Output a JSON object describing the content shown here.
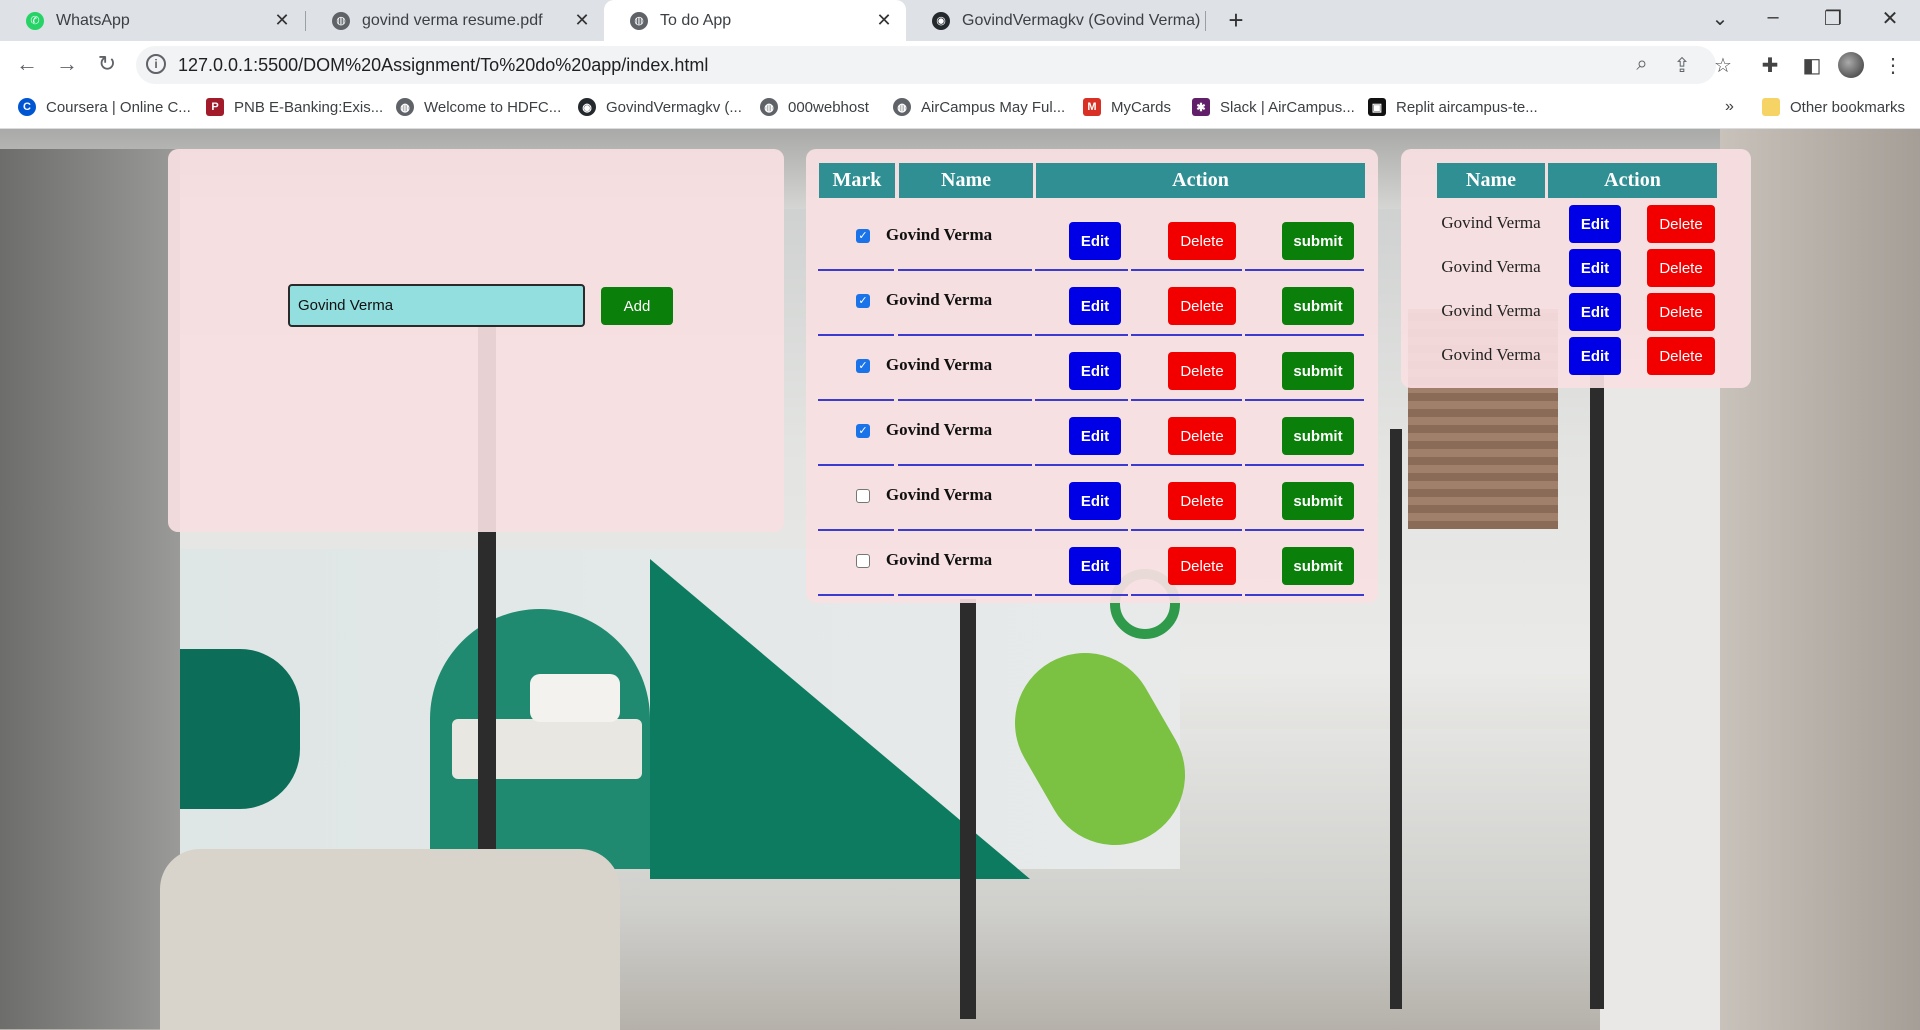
{
  "browser": {
    "tabs": [
      {
        "label": "WhatsApp",
        "icon": "whatsapp-icon",
        "color": "#25d366"
      },
      {
        "label": "govind verma resume.pdf",
        "icon": "globe-icon",
        "color": "#5f6368"
      },
      {
        "label": "To do App",
        "icon": "globe-icon",
        "color": "#5f6368"
      },
      {
        "label": "GovindVermagkv (Govind Verma)",
        "icon": "github-icon",
        "color": "#24292e"
      }
    ],
    "active_tab": 2,
    "url": "127.0.0.1:5500/DOM%20Assignment/To%20do%20app/index.html",
    "bookmarks": [
      {
        "label": "Coursera | Online C...",
        "icon": "coursera-icon",
        "color": "#0056d2",
        "glyph": "C"
      },
      {
        "label": "PNB E-Banking:Exis...",
        "icon": "pnb-icon",
        "color": "#a21b2b",
        "glyph": "P"
      },
      {
        "label": "Welcome to HDFC...",
        "icon": "globe-icon",
        "color": "#5f6368",
        "glyph": "◍"
      },
      {
        "label": "GovindVermagkv (...",
        "icon": "github-icon",
        "color": "#24292e",
        "glyph": "◉"
      },
      {
        "label": "000webhost",
        "icon": "globe-icon",
        "color": "#5f6368",
        "glyph": "◍"
      },
      {
        "label": "AirCampus May Ful...",
        "icon": "globe-icon",
        "color": "#5f6368",
        "glyph": "◍"
      },
      {
        "label": "MyCards",
        "icon": "mycards-icon",
        "color": "#d93025",
        "glyph": "M"
      },
      {
        "label": "Slack | AirCampus...",
        "icon": "slack-icon",
        "color": "#611f69",
        "glyph": "✱"
      },
      {
        "label": "Replit aircampus-te...",
        "icon": "replit-icon",
        "color": "#111111",
        "glyph": "▣"
      }
    ],
    "overflow_label": "»",
    "other_bookmarks": "Other bookmarks"
  },
  "app": {
    "input": {
      "value": "Govind Verma"
    },
    "add_label": "Add",
    "table": {
      "headers": {
        "mark": "Mark",
        "name": "Name",
        "action": "Action"
      },
      "rows": [
        {
          "checked": true,
          "name": "Govind Verma"
        },
        {
          "checked": true,
          "name": "Govind Verma"
        },
        {
          "checked": true,
          "name": "Govind Verma"
        },
        {
          "checked": true,
          "name": "Govind Verma"
        },
        {
          "checked": false,
          "name": "Govind Verma"
        },
        {
          "checked": false,
          "name": "Govind Verma"
        }
      ],
      "edit_label": "Edit",
      "delete_label": "Delete",
      "submit_label": "submit"
    },
    "submitted": {
      "headers": {
        "name": "Name",
        "action": "Action"
      },
      "rows": [
        {
          "name": "Govind Verma"
        },
        {
          "name": "Govind Verma"
        },
        {
          "name": "Govind Verma"
        },
        {
          "name": "Govind Verma"
        }
      ],
      "edit_label": "Edit",
      "delete_label": "Delete"
    }
  }
}
